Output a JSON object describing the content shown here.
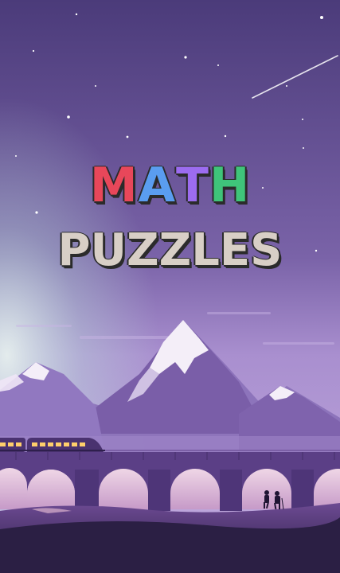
{
  "title": {
    "line1": {
      "letters": [
        {
          "char": "M",
          "color": "#e8475a"
        },
        {
          "char": "A",
          "color": "#5a9df0"
        },
        {
          "char": "T",
          "color": "#9c6cf0"
        },
        {
          "char": "H",
          "color": "#3fc47a"
        }
      ]
    },
    "line2": {
      "text": "PUZZLES",
      "color": "#d8cfc6"
    }
  },
  "scene": {
    "sky_top": "#5d4a8c",
    "sky_bottom": "#b9a0d8",
    "mountain_color": "#7a5ea8",
    "snow_color": "#f4eef8",
    "bridge_color": "#5b3f86",
    "ground_color": "#2b1f44",
    "train_color": "#4a3270",
    "window_color": "#ffcf6b"
  }
}
